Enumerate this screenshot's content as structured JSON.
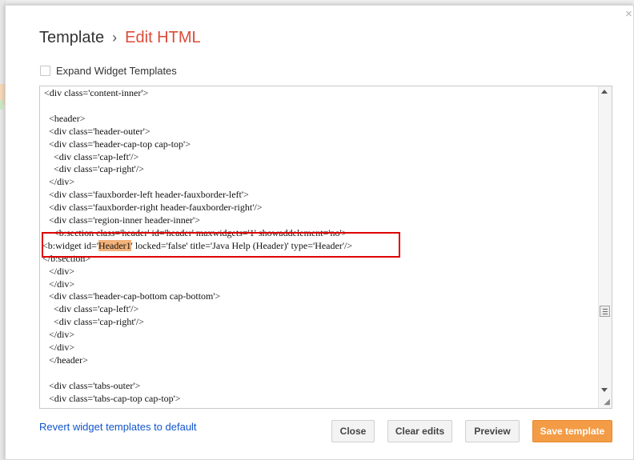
{
  "dialog": {
    "close_glyph": "×",
    "breadcrumb": {
      "parent": "Template",
      "separator": "›",
      "current": "Edit HTML"
    },
    "expand_widget_templates": {
      "label": "Expand Widget Templates",
      "checked": false
    },
    "editor": {
      "lines": [
        "<div class='content-inner'>",
        "",
        "  <header>",
        "  <div class='header-outer'>",
        "  <div class='header-cap-top cap-top'>",
        "    <div class='cap-left'/>",
        "    <div class='cap-right'/>",
        "  </div>",
        "  <div class='fauxborder-left header-fauxborder-left'>",
        "  <div class='fauxborder-right header-fauxborder-right'/>",
        "  <div class='region-inner header-inner'>",
        "    <b:section class='header' id='header' maxwidgets='1' showaddelement='no'>",
        "<b:widget id='",
        "</b:section>",
        "  </div>",
        "  </div>",
        "  <div class='header-cap-bottom cap-bottom'>",
        "    <div class='cap-left'/>",
        "    <div class='cap-right'/>",
        "  </div>",
        "  </div>",
        "  </header>",
        "",
        "  <div class='tabs-outer'>",
        "  <div class='tabs-cap-top cap-top'>"
      ],
      "highlight_line": {
        "before": "<b:widget id='",
        "highlighted": "Header1",
        "after": "' locked='false' title='Java Help (Header)' type='Header'/>"
      }
    },
    "footer": {
      "revert_link": "Revert widget templates to default",
      "buttons": {
        "close": "Close",
        "clear_edits": "Clear edits",
        "preview": "Preview",
        "save_template": "Save template"
      }
    }
  },
  "colors": {
    "accent": "#dd4b39",
    "link": "#1155cc",
    "primary_button": "#f39b45",
    "highlight": "#f3b27a",
    "annotation_box": "#dd0000"
  }
}
